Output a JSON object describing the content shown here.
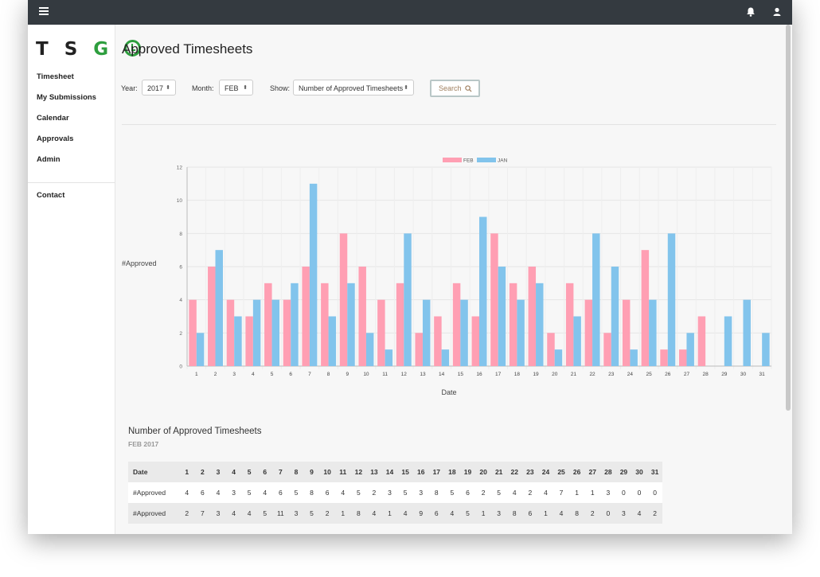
{
  "app": {
    "logo_text": "T S G",
    "logo_g": "G"
  },
  "topbar": {
    "menu_icon": "hamburger-icon",
    "bell_icon": "bell-icon",
    "user_icon": "user-icon"
  },
  "sidebar": {
    "items": [
      {
        "label": "Timesheet"
      },
      {
        "label": "My Submissions"
      },
      {
        "label": "Calendar"
      },
      {
        "label": "Approvals"
      },
      {
        "label": "Admin"
      }
    ],
    "contact_label": "Contact"
  },
  "page": {
    "title": "Approved Timesheets"
  },
  "filters": {
    "year_label": "Year:",
    "year_value": "2017",
    "month_label": "Month:",
    "month_value": "FEB",
    "show_label": "Show:",
    "show_value": "Number of Approved Timesheets",
    "search_label": "Search"
  },
  "colors": {
    "feb": "#ff9fb3",
    "jan": "#82c4ec",
    "topbar": "#343a40",
    "logo_green": "#2e9e3e"
  },
  "chart_data": {
    "type": "bar",
    "categories": [
      "1",
      "2",
      "3",
      "4",
      "5",
      "6",
      "7",
      "8",
      "9",
      "10",
      "11",
      "12",
      "13",
      "14",
      "15",
      "16",
      "17",
      "18",
      "19",
      "20",
      "21",
      "22",
      "23",
      "24",
      "25",
      "26",
      "27",
      "28",
      "29",
      "30",
      "31"
    ],
    "series": [
      {
        "name": "FEB",
        "values": [
          4,
          6,
          4,
          3,
          5,
          4,
          6,
          5,
          8,
          6,
          4,
          5,
          2,
          3,
          5,
          3,
          8,
          5,
          6,
          2,
          5,
          4,
          2,
          4,
          7,
          1,
          1,
          3,
          0,
          0,
          0
        ]
      },
      {
        "name": "JAN",
        "values": [
          2,
          7,
          3,
          4,
          4,
          5,
          11,
          3,
          5,
          2,
          1,
          8,
          4,
          1,
          4,
          9,
          6,
          4,
          5,
          1,
          3,
          8,
          6,
          1,
          4,
          8,
          2,
          0,
          3,
          4,
          2
        ]
      }
    ],
    "xlabel": "Date",
    "ylabel": "#Approved",
    "ylim": [
      0,
      12
    ],
    "yticks": [
      "0",
      "2",
      "4",
      "6",
      "8",
      "10",
      "12"
    ],
    "legend": "top",
    "grid": true
  },
  "table": {
    "title": "Number of Approved Timesheets",
    "subtitle": "FEB 2017",
    "header_label": "Date",
    "rows": [
      {
        "label": "#Approved",
        "values": [
          "4",
          "6",
          "4",
          "3",
          "5",
          "4",
          "6",
          "5",
          "8",
          "6",
          "4",
          "5",
          "2",
          "3",
          "5",
          "3",
          "8",
          "5",
          "6",
          "2",
          "5",
          "4",
          "2",
          "4",
          "7",
          "1",
          "1",
          "3",
          "0",
          "0",
          "0"
        ]
      },
      {
        "label": "#Approved",
        "values": [
          "2",
          "7",
          "3",
          "4",
          "4",
          "5",
          "11",
          "3",
          "5",
          "2",
          "1",
          "8",
          "4",
          "1",
          "4",
          "9",
          "6",
          "4",
          "5",
          "1",
          "3",
          "8",
          "6",
          "1",
          "4",
          "8",
          "2",
          "0",
          "3",
          "4",
          "2"
        ]
      }
    ]
  }
}
